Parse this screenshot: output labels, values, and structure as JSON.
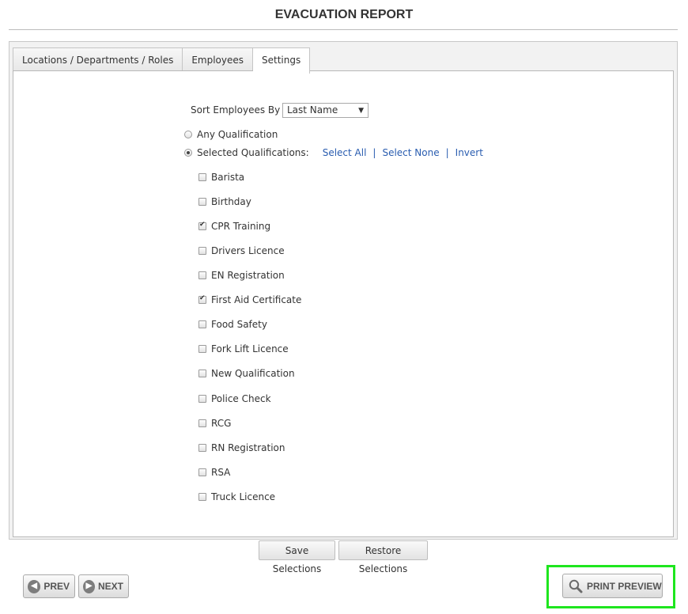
{
  "header": {
    "title": "EVACUATION REPORT"
  },
  "tabs": [
    {
      "label": "Locations / Departments / Roles",
      "active": false
    },
    {
      "label": "Employees",
      "active": false
    },
    {
      "label": "Settings",
      "active": true
    }
  ],
  "settings": {
    "sort_label": "Sort Employees By",
    "sort_value": "Last Name",
    "any_qualification_label": "Any Qualification",
    "selected_qualifications_label": "Selected Qualifications:",
    "selected_mode": "selected",
    "links": {
      "select_all": "Select All",
      "select_none": "Select None",
      "invert": "Invert",
      "separator": "|"
    },
    "qualifications": [
      {
        "label": "Barista",
        "checked": false
      },
      {
        "label": "Birthday",
        "checked": false
      },
      {
        "label": "CPR Training",
        "checked": true
      },
      {
        "label": "Drivers Licence",
        "checked": false
      },
      {
        "label": "EN Registration",
        "checked": false
      },
      {
        "label": "First Aid Certificate",
        "checked": true
      },
      {
        "label": "Food Safety",
        "checked": false
      },
      {
        "label": "Fork Lift Licence",
        "checked": false
      },
      {
        "label": "New Qualification",
        "checked": false
      },
      {
        "label": "Police Check",
        "checked": false
      },
      {
        "label": "RCG",
        "checked": false
      },
      {
        "label": "RN Registration",
        "checked": false
      },
      {
        "label": "RSA",
        "checked": false
      },
      {
        "label": "Truck Licence",
        "checked": false
      }
    ]
  },
  "actions": {
    "save_selections": "Save Selections",
    "restore_selections": "Restore Selections",
    "prev": "PREV",
    "next": "NEXT",
    "print_preview": "PRINT PREVIEW"
  },
  "icons": {
    "prev": "chevron-left-circle-icon",
    "next": "chevron-right-circle-icon",
    "print_preview": "magnifier-icon",
    "dropdown": "caret-down-icon"
  },
  "colors": {
    "highlight": "#1ee61e",
    "link": "#2a5db0"
  }
}
